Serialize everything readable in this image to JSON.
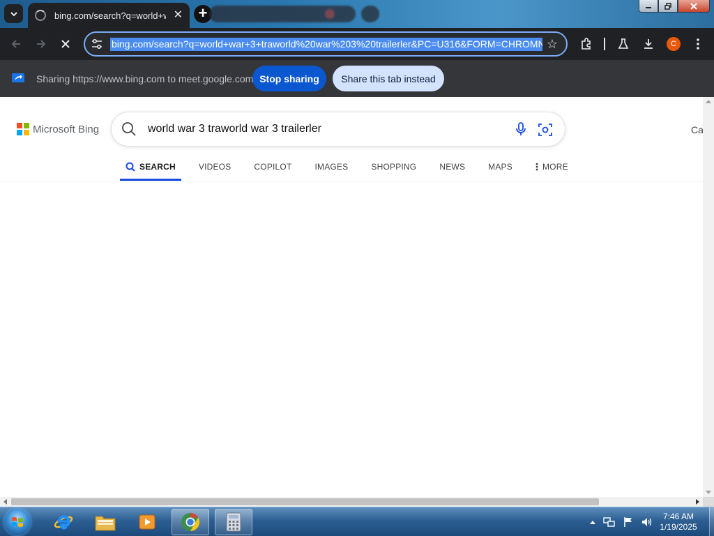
{
  "browser": {
    "tab_title": "bing.com/search?q=world+war",
    "address": "bing.com/search?q=world+war+3+traworld%20war%203%20trailerler&PC=U316&FORM=CHROMN"
  },
  "sharing_bar": {
    "message": "Sharing https://www.bing.com to meet.google.com",
    "stop_label": "Stop sharing",
    "share_tab_label": "Share this tab instead"
  },
  "profile": {
    "initial": "C",
    "color": "#e8590c"
  },
  "bing": {
    "logo_text": "Microsoft Bing",
    "query": "world war 3 traworld war 3 trailerler",
    "corner_text": "Ca",
    "nav": [
      {
        "label": "SEARCH",
        "active": true,
        "icon": "search-icon"
      },
      {
        "label": "VIDEOS"
      },
      {
        "label": "COPILOT"
      },
      {
        "label": "IMAGES"
      },
      {
        "label": "SHOPPING"
      },
      {
        "label": "NEWS"
      },
      {
        "label": "MAPS"
      },
      {
        "label": "MORE",
        "icon": "kebab-icon"
      }
    ],
    "accent_color": "#174ae4"
  },
  "taskbar": {
    "time": "7:46 AM",
    "date": "1/19/2025"
  }
}
